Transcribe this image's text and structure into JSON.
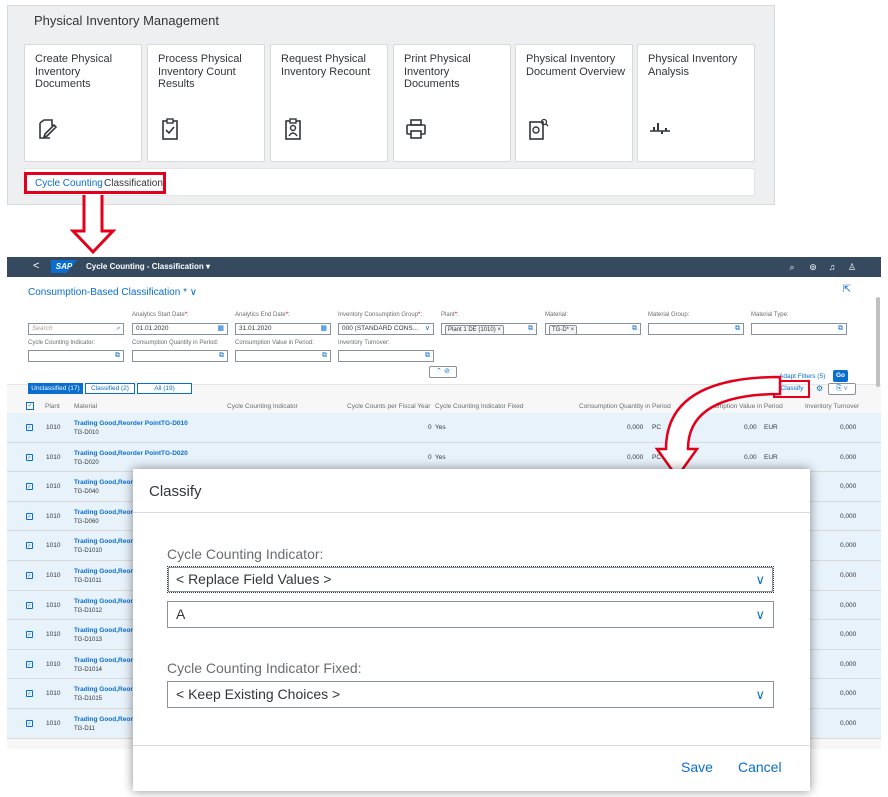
{
  "launchpad": {
    "title": "Physical Inventory Management",
    "tiles": [
      {
        "title": "Create Physical Inventory Documents",
        "icon": "edit-document-icon"
      },
      {
        "title": "Process Physical Inventory Count Results",
        "icon": "clipboard-check-icon"
      },
      {
        "title": "Request Physical Inventory Recount",
        "icon": "clipboard-person-icon"
      },
      {
        "title": "Print Physical Inventory Documents",
        "icon": "printer-icon"
      },
      {
        "title": "Physical Inventory Document Overview",
        "icon": "document-search-icon"
      },
      {
        "title": "Physical Inventory Analysis",
        "icon": "analysis-chart-icon"
      }
    ],
    "cycle_counting": {
      "link": "Cycle Counting",
      "label": "Classification"
    }
  },
  "shell": {
    "back": "<",
    "logo": "SAP",
    "title": "Cycle Counting - Classification ▾"
  },
  "header": {
    "variant": "Consumption-Based Classification * ∨",
    "search_placeholder": "Search",
    "filters": {
      "start_date_label": "Analytics Start Date",
      "start_date": "01.01.2020",
      "end_date_label": "Analytics End Date",
      "end_date": "31.01.2020",
      "group_label": "Inventory Consumption Group",
      "group": "000 (STANDARD CONS...",
      "plant_label": "Plant",
      "plant_token": "Plant 1 DE (1010)",
      "material_label": "Material:",
      "material_token": "TG-D*",
      "material_group_label": "Material Group:",
      "material_type_label": "Material Type:",
      "cci_label": "Cycle Counting Indicator:",
      "cons_qty_label": "Consumption Quantity in Period:",
      "cons_val_label": "Consumption Value in Period:",
      "turnover_label": "Inventory Turnover:"
    },
    "adapt_filters": "Adapt Filters (5)",
    "go": "Go"
  },
  "toolbar": {
    "tabs": [
      "Unclassified (17)",
      "Classified (2)",
      "All (19)"
    ],
    "classify": "Classify"
  },
  "table": {
    "columns": [
      "Plant",
      "Material",
      "Cycle Counting Indicator",
      "Cycle Counts per Fiscal Year",
      "Cycle Counting Indicator Fixed",
      "Consumption Quantity in Period",
      "Consumption Value in Period",
      "Inventory Turnover"
    ],
    "rows": [
      {
        "plant": "1010",
        "material": "Trading Good,Reorder PointTG-D010",
        "id": "TG-D010",
        "counts": "0",
        "fixed": "Yes",
        "qty": "0,000",
        "uom": "PC",
        "val": "0,00",
        "cur": "EUR",
        "turnover": "0,000"
      },
      {
        "plant": "1010",
        "material": "Trading Good,Reorder PointTG-D020",
        "id": "TG-D020",
        "counts": "0",
        "fixed": "Yes",
        "qty": "0,000",
        "uom": "PC",
        "val": "0,00",
        "cur": "EUR",
        "turnover": "0,000"
      },
      {
        "plant": "1010",
        "material": "Trading Good,Reord",
        "id": "TG-D040",
        "turnover": "0,000"
      },
      {
        "plant": "1010",
        "material": "Trading Good,Reord",
        "id": "TG-D060",
        "turnover": "0,000"
      },
      {
        "plant": "1010",
        "material": "Trading Good,Reord",
        "id": "TG-D1010",
        "turnover": "0,000"
      },
      {
        "plant": "1010",
        "material": "Trading Good,Reord",
        "id": "TG-D1011",
        "turnover": "0,000"
      },
      {
        "plant": "1010",
        "material": "Trading Good,Reord",
        "id": "TG-D1012",
        "turnover": "0,000"
      },
      {
        "plant": "1010",
        "material": "Trading Good,Reord",
        "id": "TG-D1013",
        "turnover": "0,000"
      },
      {
        "plant": "1010",
        "material": "Trading Good,Reord",
        "id": "TG-D1014",
        "turnover": "0,000"
      },
      {
        "plant": "1010",
        "material": "Trading Good,Reord",
        "id": "TG-D1015",
        "turnover": "0,000"
      },
      {
        "plant": "1010",
        "material": "Trading Good,Reord",
        "id": "TG-D11",
        "turnover": "0,000"
      }
    ]
  },
  "dialog": {
    "title": "Classify",
    "cci_label": "Cycle Counting Indicator:",
    "cci_value": "< Replace Field Values >",
    "cci_second_value": "A",
    "fixed_label": "Cycle Counting Indicator Fixed:",
    "fixed_value": "< Keep Existing Choices >",
    "save": "Save",
    "cancel": "Cancel"
  },
  "colors": {
    "accent": "#0a6ed1",
    "highlight": "#e2001a",
    "shell": "#354a5f"
  }
}
